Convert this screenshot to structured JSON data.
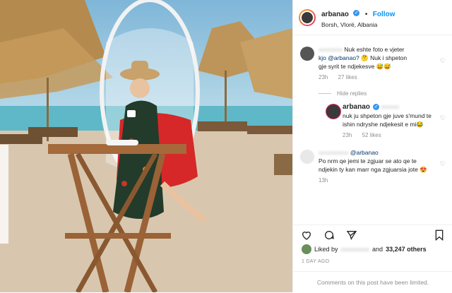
{
  "post": {
    "username": "arbanao",
    "verified_icon": "verified-badge-icon",
    "follow_label": "Follow",
    "location": "Borsh, Vlorë, Albania"
  },
  "comments": [
    {
      "user": "",
      "text_line1": "Nuk eshte foto e vjeter",
      "text_mention": "kjo @arbanao?",
      "text_rest": " 🤔 Nuk i shpeton",
      "text_line3": "gje syrit te ndjekesve 😅😅",
      "time": "23h",
      "likes": "27 likes"
    }
  ],
  "hide_replies": "Hide replies",
  "reply": {
    "user": "arbanao",
    "text": "nuk ju shpeton gje juve s'mund te ishin ndryshe ndjekesit e mi😂",
    "time": "23h",
    "likes": "52 likes"
  },
  "comment2": {
    "mention": "@arbanao",
    "text": "Po nrm qe jemi te zgjuar se ato qe te ndjekin ty kan marr nga zgjuarsia jote 😍",
    "time": "13h"
  },
  "likes_text": {
    "prefix": "Liked by",
    "suffix": "and",
    "count": "33,247 others"
  },
  "time_ago": "1 DAY AGO",
  "limited_notice": "Comments on this post have been limited."
}
